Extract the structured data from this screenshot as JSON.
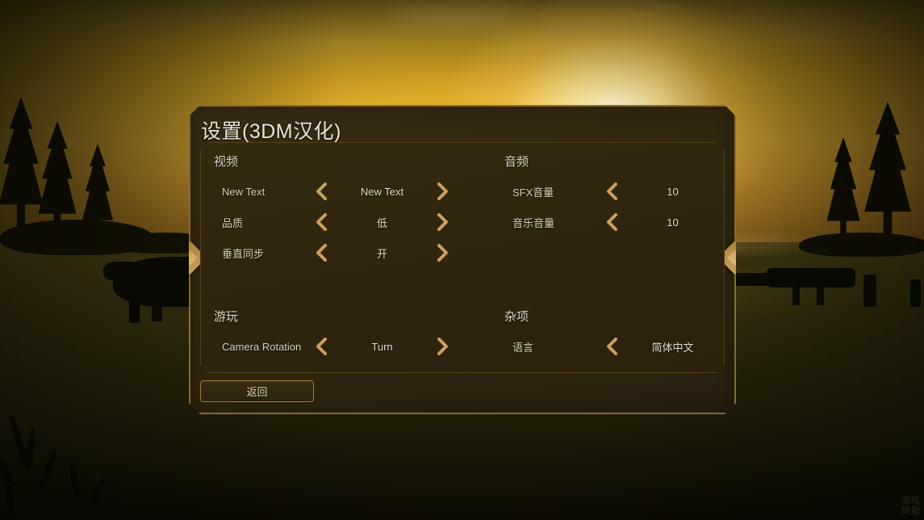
{
  "background": {
    "scene_description": "sunset landscape silhouette",
    "watermark_line1": "游戏",
    "watermark_line2": "转载"
  },
  "panel": {
    "title": "设置(3DM汉化)",
    "back_label": "返回",
    "groups": [
      {
        "id": "video",
        "title": "视频",
        "rows": [
          {
            "label": "New Text",
            "value": "New Text"
          },
          {
            "label": "品质",
            "value": "低"
          },
          {
            "label": "垂直同步",
            "value": "开"
          }
        ]
      },
      {
        "id": "audio",
        "title": "音频",
        "rows": [
          {
            "label": "SFX音量",
            "value": "10"
          },
          {
            "label": "音乐音量",
            "value": "10"
          }
        ]
      },
      {
        "id": "gameplay",
        "title": "游玩",
        "rows": [
          {
            "label": "Camera Rotation",
            "value": "Turn"
          }
        ]
      },
      {
        "id": "misc",
        "title": "杂项",
        "rows": [
          {
            "label": "语言",
            "value": "简体中文"
          }
        ]
      }
    ]
  },
  "colors": {
    "panel_border": "#8a6a2c",
    "panel_fill": "#32270f",
    "title_text": "#eae2d2",
    "label_text": "#d8cfba",
    "arrow_gold": "#c9a060",
    "diamond_gold": "#c9a05a",
    "sky_gold": "#dfae2b",
    "ground_dark": "#2b260c"
  }
}
